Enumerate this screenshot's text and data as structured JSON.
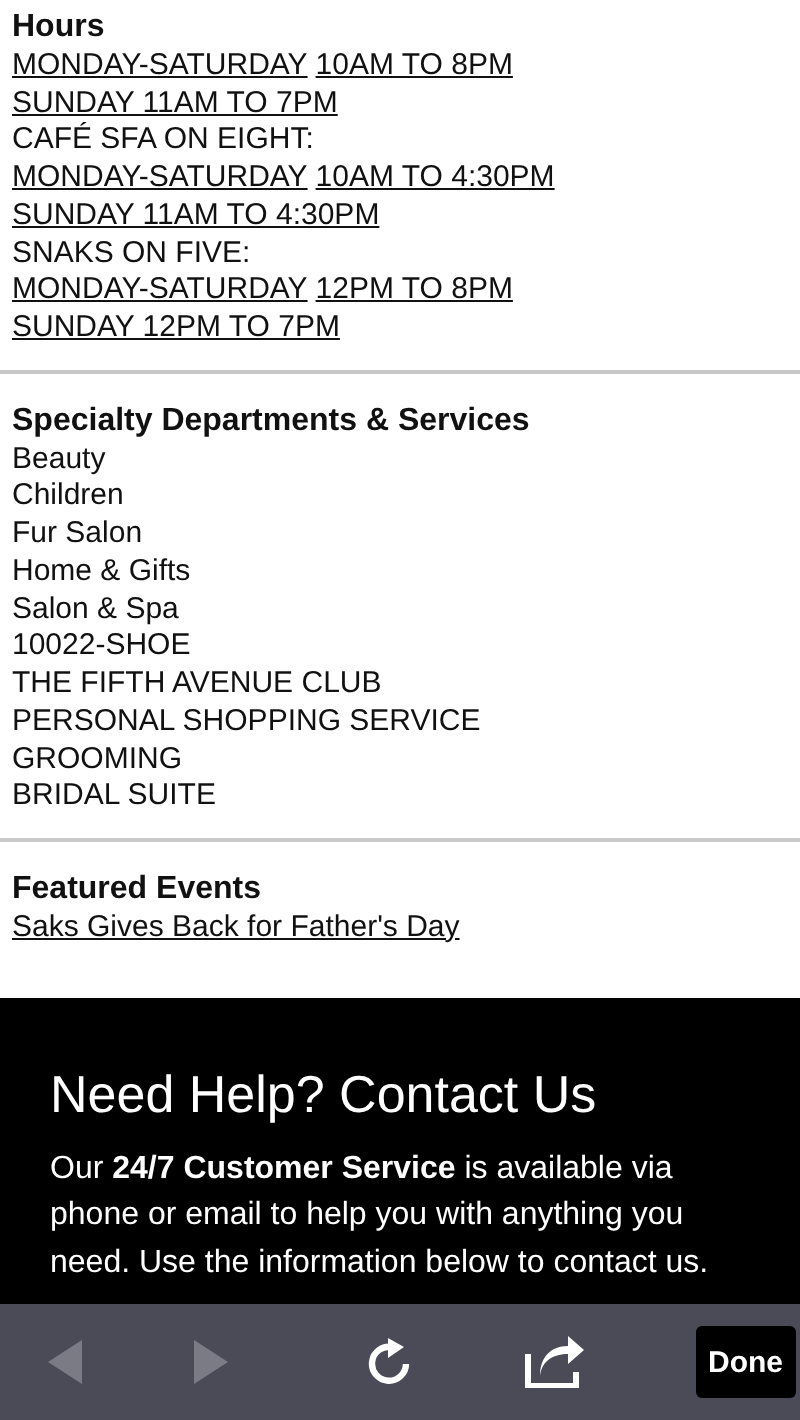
{
  "hours": {
    "title": "Hours",
    "lines": [
      {
        "kind": "split",
        "day": "MONDAY-SATURDAY",
        "time": "10AM TO 8PM"
      },
      {
        "kind": "link",
        "text": "SUNDAY 11AM TO 7PM"
      },
      {
        "kind": "plain",
        "text": "CAFÉ SFA ON EIGHT:"
      },
      {
        "kind": "split",
        "day": "MONDAY-SATURDAY",
        "time": "10AM TO 4:30PM"
      },
      {
        "kind": "link",
        "text": "SUNDAY 11AM TO 4:30PM"
      },
      {
        "kind": "plain",
        "text": "SNAKS ON FIVE:"
      },
      {
        "kind": "split",
        "day": "MONDAY-SATURDAY",
        "time": "12PM TO 8PM"
      },
      {
        "kind": "link",
        "text": "SUNDAY 12PM TO 7PM"
      }
    ]
  },
  "departments": {
    "title": "Specialty Departments & Services",
    "items": [
      "Beauty",
      "Children",
      "Fur Salon",
      "Home & Gifts",
      "Salon & Spa",
      "10022-SHOE",
      "THE FIFTH AVENUE CLUB",
      "PERSONAL SHOPPING SERVICE",
      "GROOMING",
      "BRIDAL SUITE"
    ]
  },
  "events": {
    "title": "Featured Events",
    "links": [
      "Saks Gives Back for Father's Day"
    ]
  },
  "help": {
    "title": "Need Help? Contact Us",
    "text": "Our **24/7 Customer Service** is available via phone or email to help you with anything you need. Use the information below to contact us."
  },
  "toolbar": {
    "back_disabled": true,
    "forward_disabled": true,
    "done": "Done"
  }
}
